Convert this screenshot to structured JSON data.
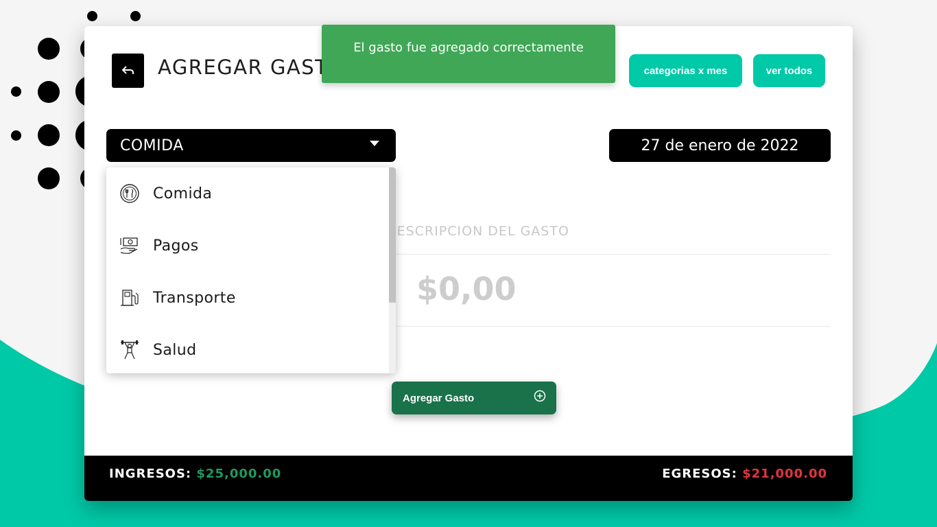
{
  "header": {
    "title": "AGREGAR GASTO",
    "categories_button": "categorias x mes",
    "view_all_button": "ver todos"
  },
  "form": {
    "category_selected": "COMIDA",
    "date": "27 de enero de 2022",
    "description_placeholder": "DESCRIPCION DEL GASTO",
    "amount_placeholder": "$0,00",
    "submit_label": "Agregar Gasto"
  },
  "dropdown": {
    "items": [
      {
        "label": "Comida",
        "icon": "restaurant-icon"
      },
      {
        "label": "Pagos",
        "icon": "money-hand-icon"
      },
      {
        "label": "Transporte",
        "icon": "fuel-pump-icon"
      },
      {
        "label": "Salud",
        "icon": "weightlifter-icon"
      }
    ]
  },
  "footer": {
    "income_label": "INGRESOS:",
    "income_value": "$25,000.00",
    "expense_label": "EGRESOS:",
    "expense_value": "$21,000.00"
  },
  "toast": {
    "message": "El gasto fue agregado correctamente"
  },
  "colors": {
    "accent_teal": "#00c9a7",
    "toast_green": "#3fa756",
    "submit_green": "#19724a",
    "income_green": "#1f9a5f",
    "expense_red": "#e0363f"
  }
}
